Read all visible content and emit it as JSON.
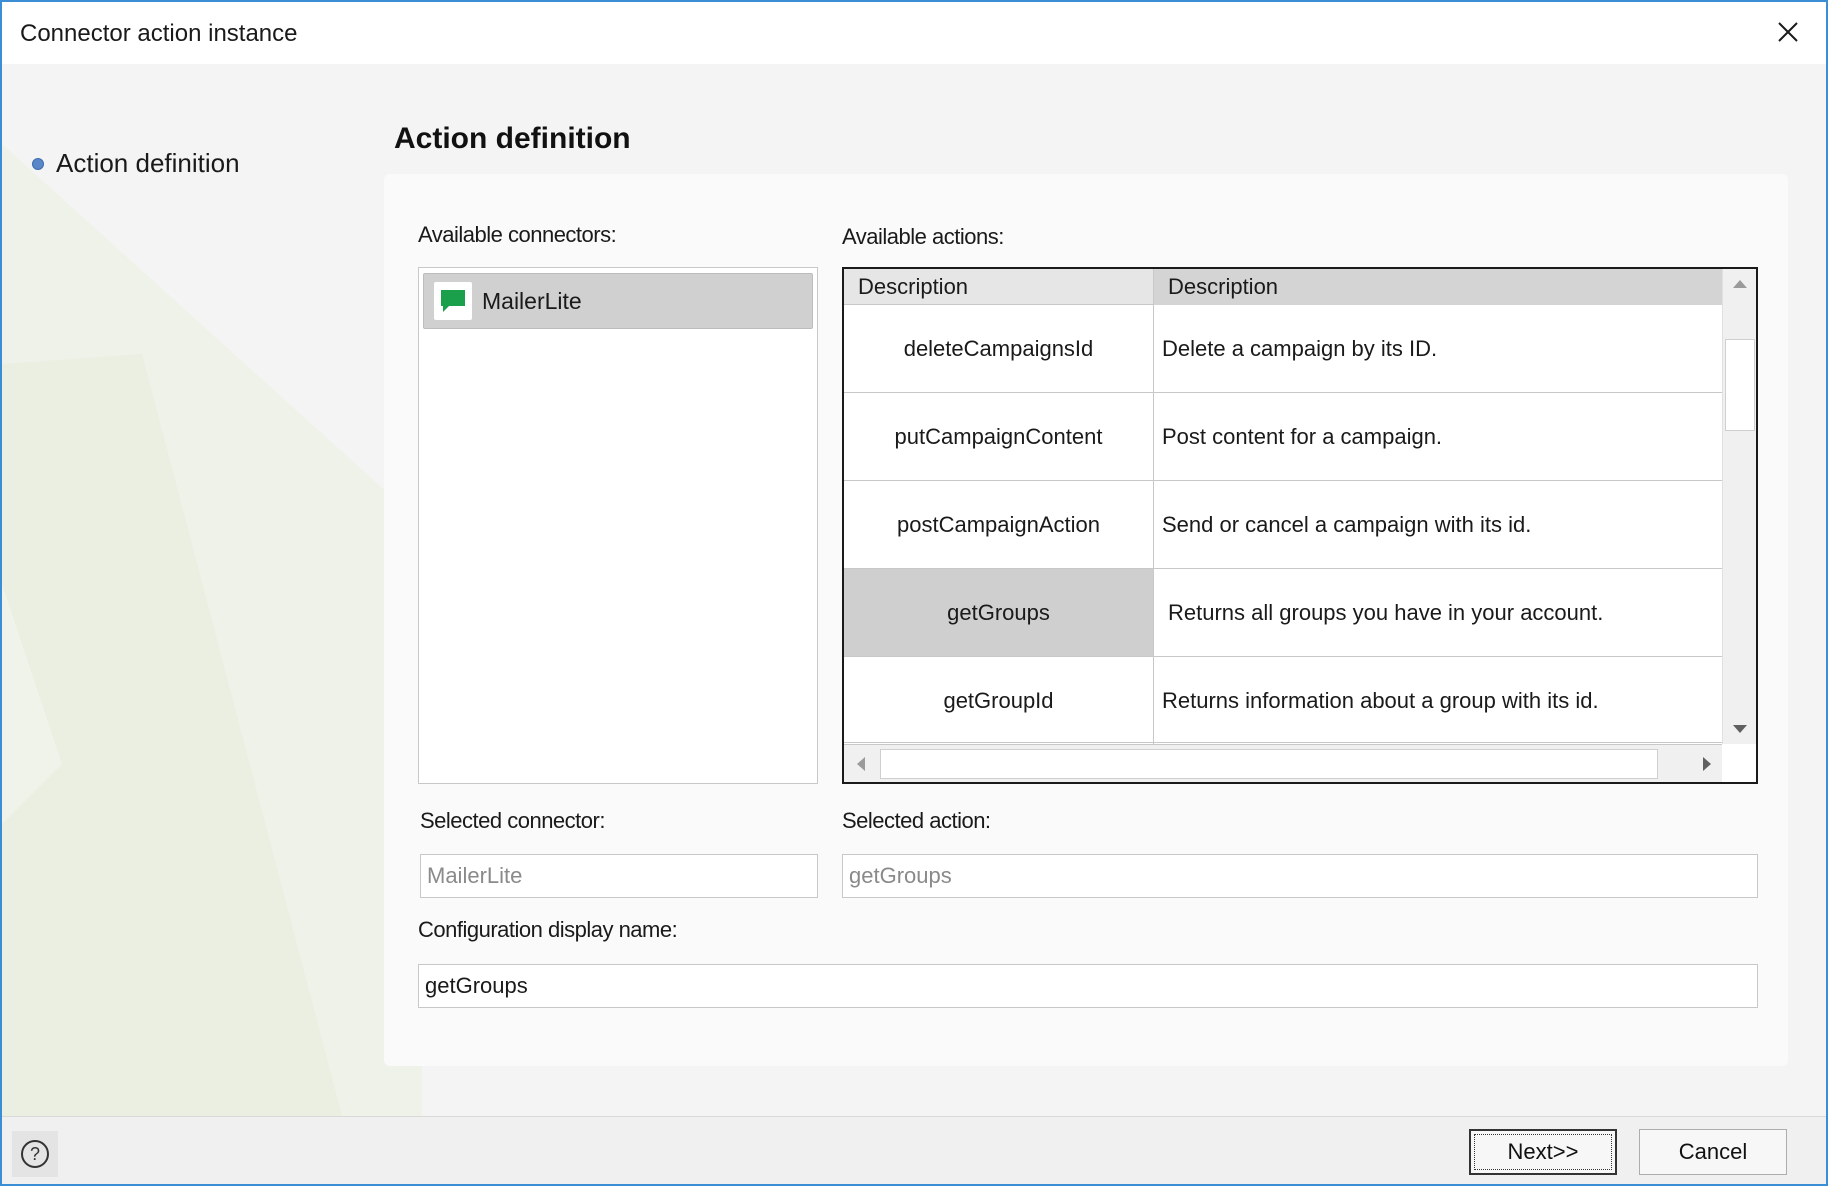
{
  "window": {
    "title": "Connector action instance"
  },
  "steps": [
    {
      "label": "Action definition"
    }
  ],
  "main": {
    "heading": "Action definition"
  },
  "connectors": {
    "label": "Available connectors:",
    "items": [
      {
        "name": "MailerLite",
        "icon": "chat-bubble-icon",
        "icon_color": "#1aa04a"
      }
    ]
  },
  "actions": {
    "label": "Available actions:",
    "columns": [
      "Description",
      "Description"
    ],
    "rows": [
      {
        "name": "deleteCampaignsId",
        "description": "Delete a campaign by its ID."
      },
      {
        "name": "putCampaignContent",
        "description": "Post content for a campaign."
      },
      {
        "name": "postCampaignAction",
        "description": "Send or cancel a campaign with its id."
      },
      {
        "name": "getGroups",
        "description": "Returns all groups you have in your account."
      },
      {
        "name": "getGroupId",
        "description": "Returns information about a group with its id."
      }
    ],
    "selected_index": 3
  },
  "selected_connector": {
    "label": "Selected connector:",
    "value": "MailerLite"
  },
  "selected_action": {
    "label": "Selected action:",
    "value": "getGroups"
  },
  "config_name": {
    "label": "Configuration display name:",
    "value": "getGroups"
  },
  "footer": {
    "help": "?",
    "next_label": "Next>>",
    "cancel_label": "Cancel"
  }
}
